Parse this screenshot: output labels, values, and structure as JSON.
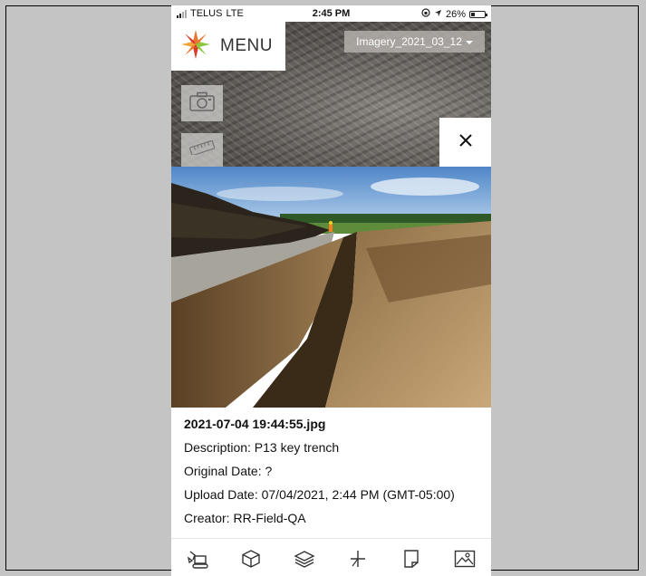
{
  "status_bar": {
    "carrier": "TELUS",
    "network": "LTE",
    "time": "2:45 PM",
    "battery": "26%"
  },
  "header": {
    "menu_label": "MENU",
    "imagery_select": "Imagery_2021_03_12"
  },
  "photo_details": {
    "filename": "2021-07-04 19:44:55.jpg",
    "description": "Description: P13 key trench",
    "original_date": "Original Date: ?",
    "upload_date": "Upload Date: 07/04/2021, 2:44 PM (GMT-05:00)",
    "creator": "Creator: RR-Field-QA"
  },
  "map_tools": [
    "camera-icon",
    "ruler-icon"
  ],
  "bottom_tabs": [
    "excavator-icon",
    "cube-icon",
    "layers-icon",
    "plus-sparkle-icon",
    "document-icon",
    "image-icon"
  ],
  "colors": {
    "background": "#c4c4c4",
    "imagery_select_bg": "#b4afaa",
    "logo_orange": "#e8762c",
    "logo_green": "#8cc63f",
    "logo_red": "#d83a2c"
  }
}
